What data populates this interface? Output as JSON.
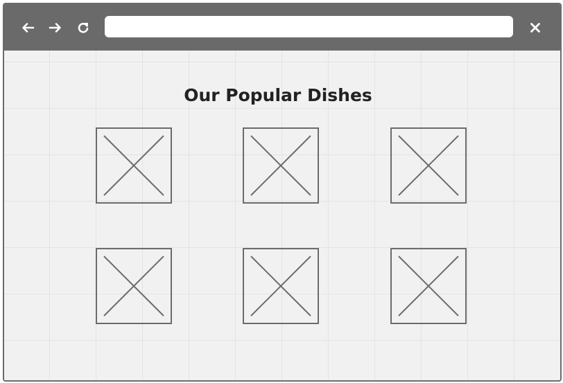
{
  "browser": {
    "back_icon": "arrow-left-icon",
    "forward_icon": "arrow-right-icon",
    "reload_icon": "reload-icon",
    "close_icon": "close-icon",
    "url": ""
  },
  "main": {
    "title": "Our Popular Dishes",
    "dishes": [
      {
        "image": "image-placeholder"
      },
      {
        "image": "image-placeholder"
      },
      {
        "image": "image-placeholder"
      },
      {
        "image": "image-placeholder"
      },
      {
        "image": "image-placeholder"
      },
      {
        "image": "image-placeholder"
      }
    ]
  },
  "colors": {
    "toolbar": "#6a6a6a",
    "canvas": "#f1f1f1",
    "stroke": "#6b6b6b"
  }
}
